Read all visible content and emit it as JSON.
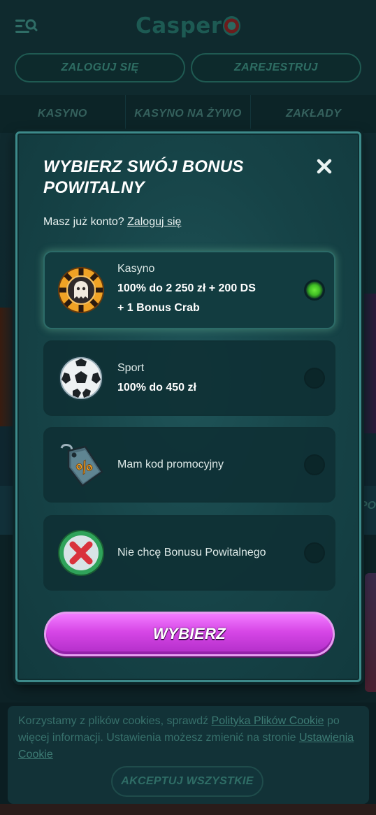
{
  "header": {
    "logo_text": "Casper",
    "login_label": "ZALOGUJ SIĘ",
    "register_label": "ZAREJESTRUJ"
  },
  "nav": {
    "tabs": [
      "KASYNO",
      "KASYNO NA ŻYWO",
      "ZAKŁADY"
    ]
  },
  "background": {
    "strip_text": "PO"
  },
  "modal": {
    "title_line1": "WYBIERZ SWÓJ BONUS",
    "title_line2": "POWITALNY",
    "login_prompt": "Masz już konto?",
    "login_link": "Zaloguj się",
    "options": [
      {
        "title": "Kasyno",
        "desc_line1": "100% do 2 250 zł + 200 DS",
        "desc_line2": "+ 1 Bonus Crab",
        "selected": true,
        "icon": "casino-chip-icon"
      },
      {
        "title": "Sport",
        "desc_line1": "100% do 450 zł",
        "selected": false,
        "icon": "soccer-ball-icon"
      },
      {
        "title": "Mam kod promocyjny",
        "selected": false,
        "icon": "promo-tag-icon"
      },
      {
        "title": "Nie chcę Bonusu Powitalnego",
        "selected": false,
        "icon": "no-bonus-icon"
      }
    ],
    "choose_label": "WYBIERZ",
    "accent_color": "#d646e6",
    "selected_radio_color": "#3fbd24"
  },
  "cookie": {
    "text_1": "Korzystamy z plików cookies, sprawdź",
    "link_1": "Polityka Plików Cookie",
    "text_2": "po więcej informacji. Ustawienia możesz zmienić na stronie",
    "link_2": "Ustawienia Cookie",
    "accept_label": "AKCEPTUJ WSZYSTKIE"
  }
}
